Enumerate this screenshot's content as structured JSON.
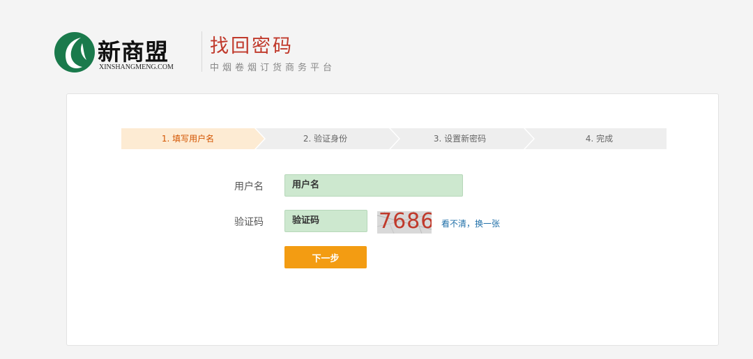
{
  "brand": {
    "name_cn": "新商盟",
    "name_en": "XINSHANGMENG.COM",
    "colors": {
      "logo": "#1a7a4c"
    }
  },
  "header": {
    "title": "找回密码",
    "subtitle": "中烟卷烟订货商务平台",
    "title_color": "#c0392b"
  },
  "steps": [
    {
      "label": "1. 填写用户名",
      "active": true
    },
    {
      "label": "2. 验证身份",
      "active": false
    },
    {
      "label": "3. 设置新密码",
      "active": false
    },
    {
      "label": "4. 完成",
      "active": false
    }
  ],
  "form": {
    "username": {
      "label": "用户名",
      "value": "用户名"
    },
    "captcha": {
      "label": "验证码",
      "value": "验证码",
      "image_text": "7686",
      "refresh_link": "看不清，换一张"
    },
    "next_button": "下一步"
  },
  "colors": {
    "accent": "#f39c12",
    "active_step_bg": "#fdebd3",
    "field_bg": "#cde8cf"
  }
}
